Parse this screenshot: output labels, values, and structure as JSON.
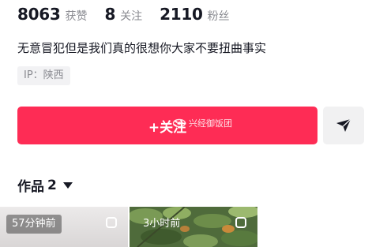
{
  "profile": {
    "stats": [
      {
        "value": "8063",
        "label": "获赞"
      },
      {
        "value": "8",
        "label": "关注"
      },
      {
        "value": "2110",
        "label": "粉丝"
      }
    ],
    "bio": "无意冒犯但是我们真的很想你大家不要扭曲事实",
    "ip": "IP：陕西"
  },
  "actions": {
    "follow_label": "+关注",
    "watermark_text": "兴经御饭团",
    "share_icon": "send-icon"
  },
  "works": {
    "label": "作品",
    "count": "2"
  },
  "videos": [
    {
      "time": "57分钟前"
    },
    {
      "time": "3小时前"
    }
  ],
  "colors": {
    "accent": "#fe2c55",
    "secondary_button": "#f1f1f2",
    "muted_text": "#8a8b91"
  }
}
